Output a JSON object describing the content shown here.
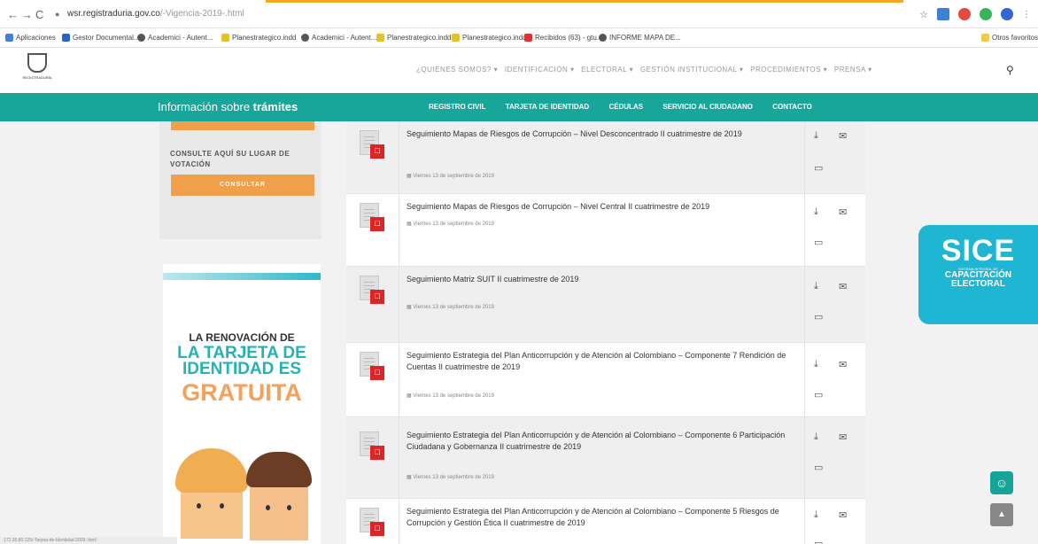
{
  "browser": {
    "url_host": "wsr.registraduria.gov.co",
    "url_path": "/-Vigencia-2019-.html",
    "bookmarks": [
      "Aplicaciones",
      "Gestor Documental...",
      "Academici - Autent...",
      "Planestrategico.indd",
      "Academici - Autent...",
      "Planestrategico.indd",
      "Planestrategico.indd",
      "Recibidos (63) - gtu...",
      "INFORME MAPA DE..."
    ],
    "other_bookmarks": "Otros favoritos"
  },
  "header": {
    "nav": [
      "¿QUIÉNES SOMOS? ▾",
      "IDENTIFICACIÓN ▾",
      "ELECTORAL ▾",
      "GESTIÓN INSTITUCIONAL ▾",
      "PROCEDIMIENTOS ▾",
      "PRENSA ▾"
    ]
  },
  "tramites": {
    "title_prefix": "Información sobre ",
    "title_bold": "trámites",
    "links": [
      "REGISTRO CIVIL",
      "TARJETA DE IDENTIDAD",
      "CÉDULAS",
      "SERVICIO AL CIUDADANO",
      "CONTACTO"
    ]
  },
  "sidebar": {
    "label": "CONSULTE AQUÍ SU LUGAR DE VOTACIÓN",
    "button": "CONSULTAR",
    "banner": {
      "line1": "LA RENOVACIÓN DE",
      "line2": "LA TARJETA DE IDENTIDAD ES",
      "line3": "GRATUITA"
    }
  },
  "documents": [
    {
      "title": "Seguimiento Mapas de Riesgos de Corrupción – Nivel Desconcentrado II cuatrimestre de 2019",
      "date": "Viernes 13 de septiembre de 2019"
    },
    {
      "title": "Seguimiento Mapas de Riesgos de Corrupción – Nivel Central II cuatrimestre de 2019",
      "date": "Viernes 13 de septiembre de 2019"
    },
    {
      "title": "Seguimiento Matriz SUIT II cuatrimestre de 2019",
      "date": "Viernes 13 de septiembre de 2019"
    },
    {
      "title": "Seguimiento Estrategia del Plan Anticorrupción y de Atención al Colombiano – Componente 7 Rendición de Cuentas II cuatrimestre de 2019",
      "date": "Viernes 13 de septiembre de 2019"
    },
    {
      "title": "Seguimiento Estrategia del Plan Anticorrupción y de Atención al Colombiano – Componente 6 Participación Ciudadana y Gobernanza II cuatrimestre de 2019",
      "date": "Viernes 13 de septiembre de 2019"
    },
    {
      "title": "Seguimiento Estrategia del Plan Anticorrupción y de Atención al Colombiano – Componente 5 Riesgos de Corrupción y Gestión Ética II cuatrimestre de 2019",
      "date": ""
    }
  ],
  "sice": {
    "title": "SICE",
    "subtitle": "SISTEMA INTEGRAL DE",
    "line1": "CAPACITACIÓN",
    "line2": "ELECTORAL"
  },
  "status": "172.30.80.125/-Tarjeta-de-Identidad-2009-.html",
  "colors": {
    "teal": "#18a59a",
    "orange": "#f0a04b",
    "pdf_red": "#e02424",
    "sice": "#1fb6d4"
  }
}
